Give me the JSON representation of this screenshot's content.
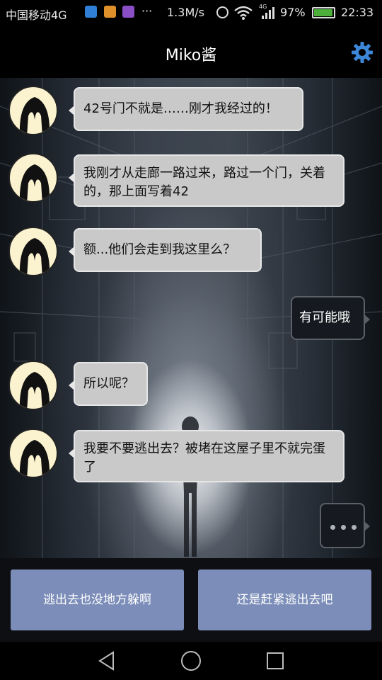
{
  "status_bar": {
    "carrier": "中国移动4G",
    "overflow": "···",
    "net_speed": "1.3M/s",
    "network_type": "4G",
    "battery_percent": "97%",
    "battery_level": 0.97,
    "time": "22:33",
    "icons": [
      "app-notification-icon",
      "app-notification-icon",
      "app-notification-icon",
      "alarm-icon",
      "wifi-icon",
      "signal-icon",
      "battery-icon"
    ]
  },
  "header": {
    "title": "Miko酱",
    "settings_icon": "gear-icon",
    "accent": "#3d86d8"
  },
  "messages": [
    {
      "side": "left",
      "text": "42号门不就是……刚才我经过的！"
    },
    {
      "side": "left",
      "text": "我刚才从走廊一路过来，路过一个门，关着的，那上面写着42"
    },
    {
      "side": "left",
      "text": "额...他们会走到我这里么？"
    },
    {
      "side": "right",
      "text": "有可能哦"
    },
    {
      "side": "left",
      "text": "所以呢？"
    },
    {
      "side": "left",
      "text": "我要不要逃出去？被堵在这屋子里不就完蛋了"
    }
  ],
  "typing_indicator": "···",
  "choices": [
    {
      "label": "逃出去也没地方躲啊"
    },
    {
      "label": "还是赶紧逃出去吧"
    }
  ],
  "colors": {
    "choice_button": "#7b8db8",
    "npc_bubble": "#c9c9c9",
    "player_bubble": "#161a20"
  },
  "nav": {
    "back_icon": "back-triangle-icon",
    "home_icon": "home-circle-icon",
    "recents_icon": "recents-square-icon"
  }
}
